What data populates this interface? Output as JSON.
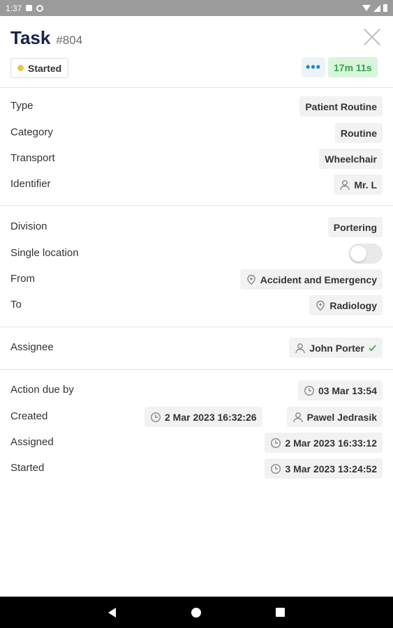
{
  "status_bar": {
    "time": "1:37"
  },
  "header": {
    "title": "Task",
    "task_id": "#804",
    "status": "Started",
    "more_label": "•••",
    "timer": "17m 11s"
  },
  "details": {
    "type": {
      "label": "Type",
      "value": "Patient Routine"
    },
    "category": {
      "label": "Category",
      "value": "Routine"
    },
    "transport": {
      "label": "Transport",
      "value": "Wheelchair"
    },
    "identifier": {
      "label": "Identifier",
      "value": "Mr. L"
    }
  },
  "location": {
    "division": {
      "label": "Division",
      "value": "Portering"
    },
    "single_location": {
      "label": "Single location",
      "enabled": false
    },
    "from": {
      "label": "From",
      "value": "Accident and Emergency"
    },
    "to": {
      "label": "To",
      "value": "Radiology"
    }
  },
  "assignee": {
    "label": "Assignee",
    "value": "John Porter"
  },
  "timeline": {
    "action_due": {
      "label": "Action due by",
      "value": "03 Mar 13:54"
    },
    "created": {
      "label": "Created",
      "value": "2 Mar 2023 16:32:26",
      "by": "Pawel Jedrasik"
    },
    "assigned": {
      "label": "Assigned",
      "value": "2 Mar 2023 16:33:12"
    },
    "started": {
      "label": "Started",
      "value": "3 Mar 2023 13:24:52"
    }
  },
  "colors": {
    "accent": "#1f88c9",
    "title": "#17224a",
    "timer_bg": "#d9f5dc",
    "timer_text": "#2fa545",
    "status_dot": "#e8c547",
    "check": "#4caf50"
  }
}
